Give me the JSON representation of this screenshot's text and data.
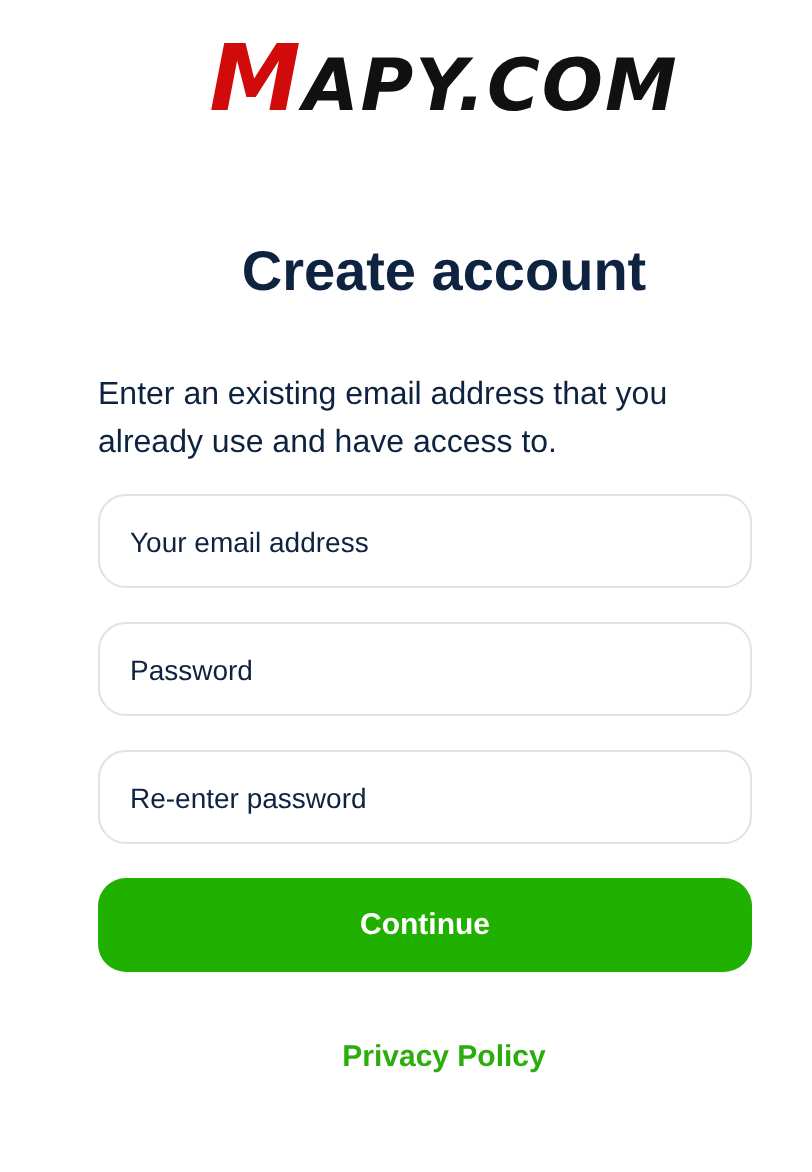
{
  "logo": {
    "first_letter": "M",
    "rest": "APY.COM"
  },
  "title": "Create account",
  "intro": "Enter an existing email address that you already use and have access to.",
  "fields": [
    {
      "placeholder": "Your email address"
    },
    {
      "placeholder": "Password"
    },
    {
      "placeholder": "Re-enter password"
    }
  ],
  "submit": "Continue",
  "footer_link": "Privacy Policy"
}
